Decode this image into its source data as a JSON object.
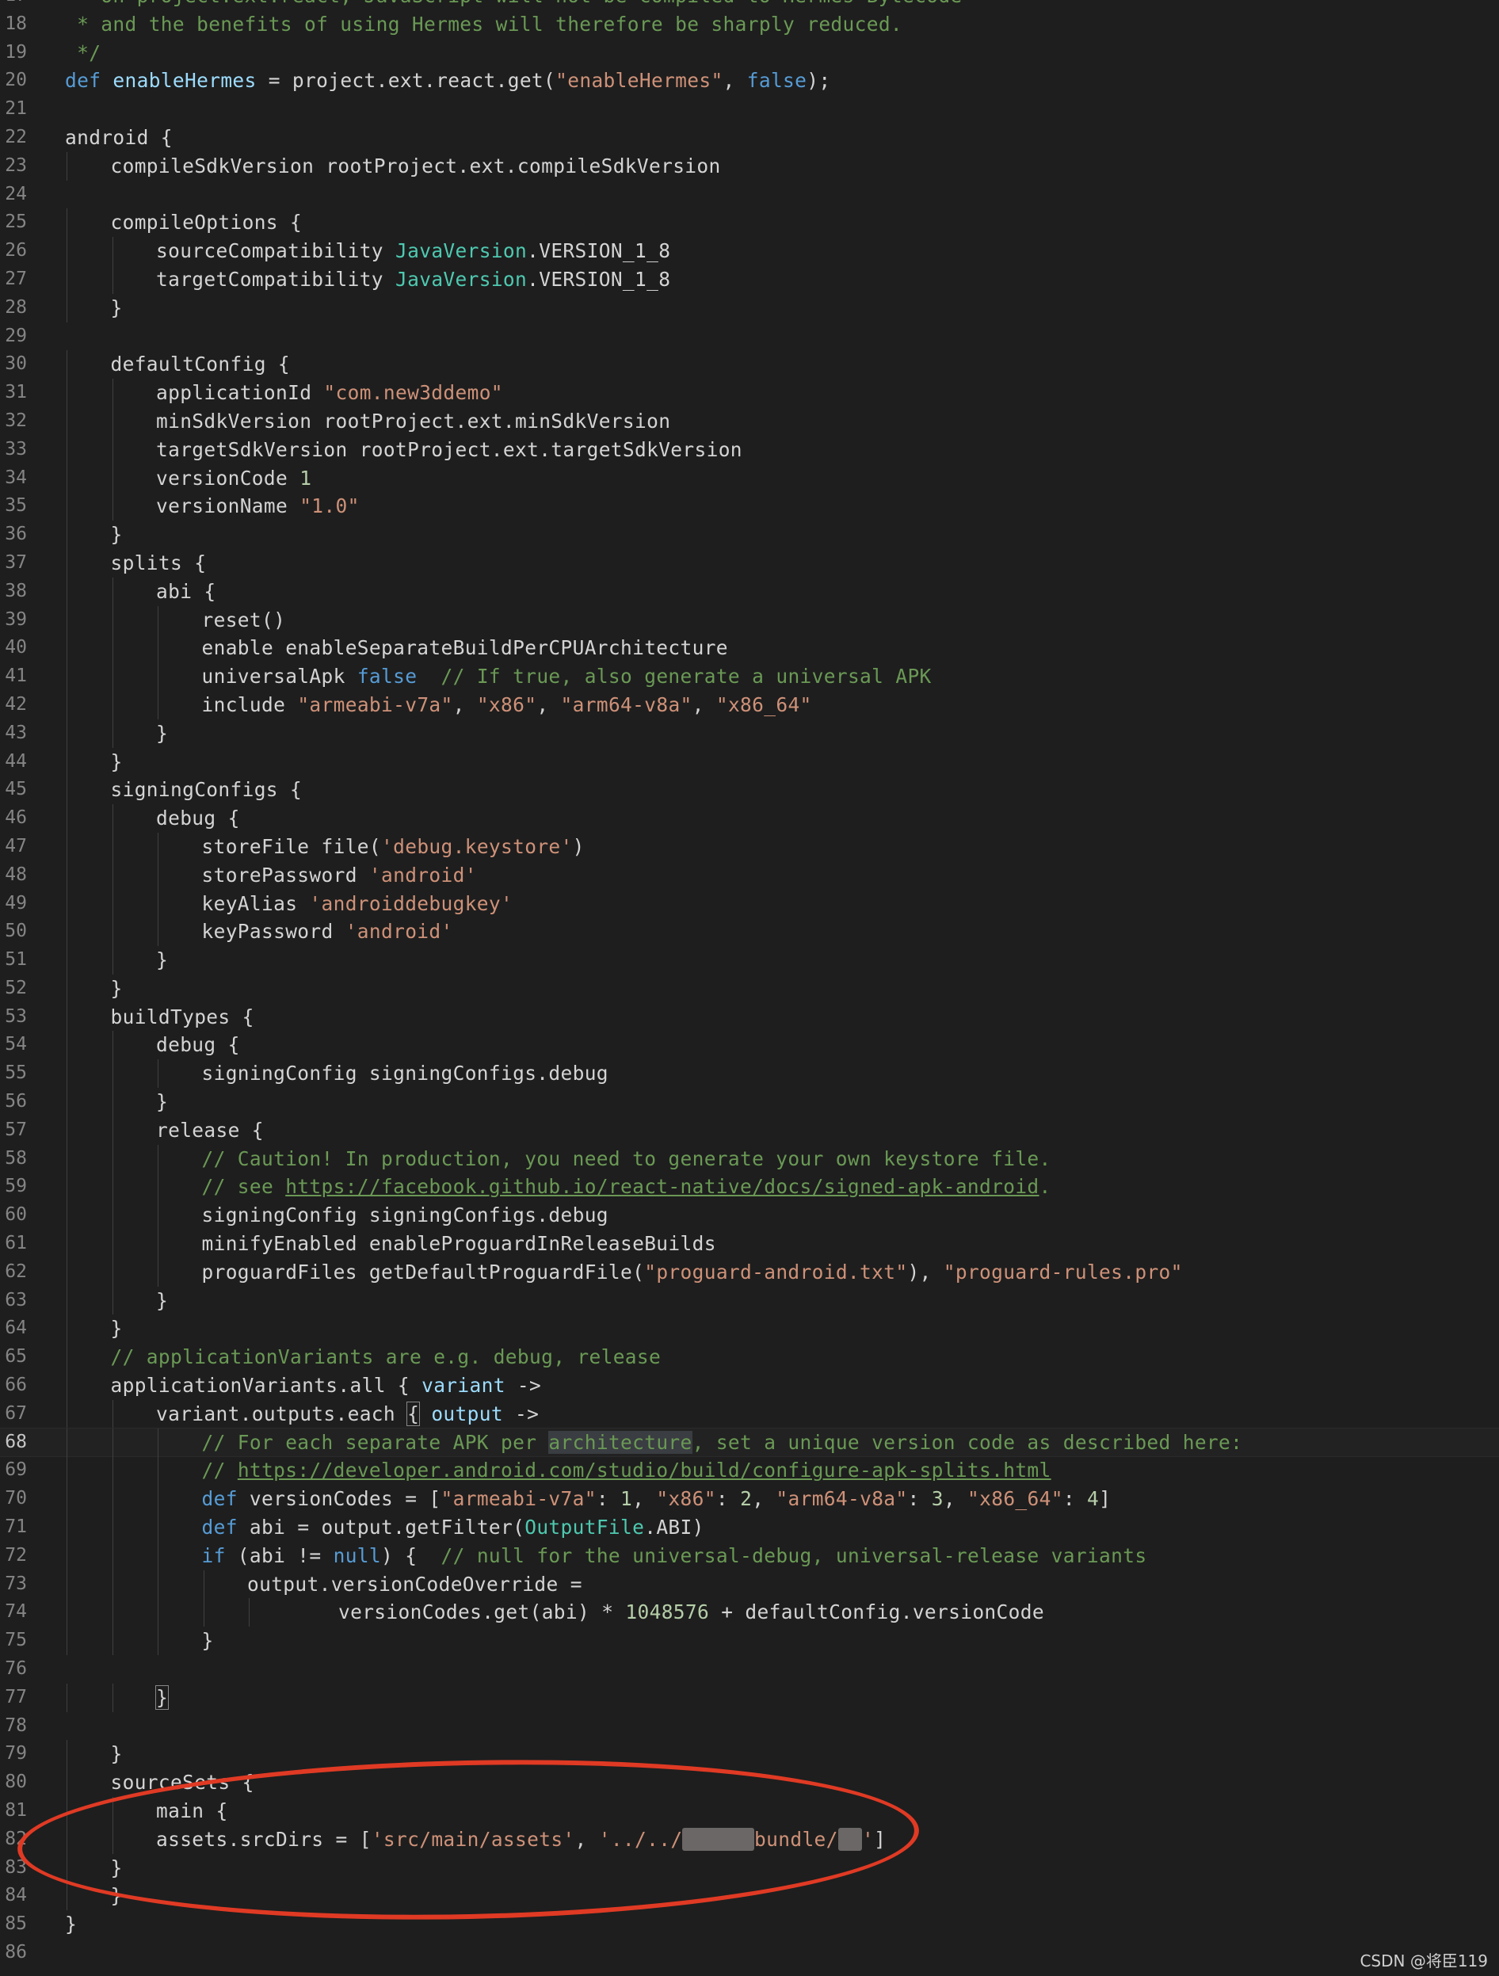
{
  "editor": {
    "current_line": "68",
    "lines": [
      {
        "n": "17",
        "indent": 0,
        "tokens": [
          {
            "t": " * on project.ext.react, JavaScript will not be compiled to Hermes Bytecode",
            "c": "com"
          }
        ]
      },
      {
        "n": "18",
        "indent": 0,
        "tokens": [
          {
            "t": " * and the benefits of using Hermes will therefore be sharply reduced.",
            "c": "com"
          }
        ]
      },
      {
        "n": "19",
        "indent": 0,
        "tokens": [
          {
            "t": " */",
            "c": "com"
          }
        ]
      },
      {
        "n": "20",
        "indent": 0,
        "tokens": [
          {
            "t": "def",
            "c": "kw"
          },
          {
            "t": " "
          },
          {
            "t": "enableHermes",
            "c": "var"
          },
          {
            "t": " = project.ext.react.get("
          },
          {
            "t": "\"enableHermes\"",
            "c": "str"
          },
          {
            "t": ", "
          },
          {
            "t": "false",
            "c": "kw"
          },
          {
            "t": ");"
          }
        ]
      },
      {
        "n": "21",
        "indent": 0,
        "tokens": []
      },
      {
        "n": "22",
        "indent": 0,
        "tokens": [
          {
            "t": "android {"
          }
        ]
      },
      {
        "n": "23",
        "indent": 1,
        "tokens": [
          {
            "t": "compileSdkVersion rootProject.ext.compileSdkVersion"
          }
        ]
      },
      {
        "n": "24",
        "indent": 0,
        "tokens": []
      },
      {
        "n": "25",
        "indent": 1,
        "tokens": [
          {
            "t": "compileOptions {"
          }
        ]
      },
      {
        "n": "26",
        "indent": 2,
        "tokens": [
          {
            "t": "sourceCompatibility "
          },
          {
            "t": "JavaVersion",
            "c": "type"
          },
          {
            "t": ".VERSION_1_8"
          }
        ]
      },
      {
        "n": "27",
        "indent": 2,
        "tokens": [
          {
            "t": "targetCompatibility "
          },
          {
            "t": "JavaVersion",
            "c": "type"
          },
          {
            "t": ".VERSION_1_8"
          }
        ]
      },
      {
        "n": "28",
        "indent": 1,
        "tokens": [
          {
            "t": "}"
          }
        ]
      },
      {
        "n": "29",
        "indent": 0,
        "tokens": []
      },
      {
        "n": "30",
        "indent": 1,
        "tokens": [
          {
            "t": "defaultConfig {"
          }
        ]
      },
      {
        "n": "31",
        "indent": 2,
        "tokens": [
          {
            "t": "applicationId "
          },
          {
            "t": "\"com.new3ddemo\"",
            "c": "str"
          }
        ]
      },
      {
        "n": "32",
        "indent": 2,
        "tokens": [
          {
            "t": "minSdkVersion rootProject.ext.minSdkVersion"
          }
        ]
      },
      {
        "n": "33",
        "indent": 2,
        "tokens": [
          {
            "t": "targetSdkVersion rootProject.ext.targetSdkVersion"
          }
        ]
      },
      {
        "n": "34",
        "indent": 2,
        "tokens": [
          {
            "t": "versionCode "
          },
          {
            "t": "1",
            "c": "num"
          }
        ]
      },
      {
        "n": "35",
        "indent": 2,
        "tokens": [
          {
            "t": "versionName "
          },
          {
            "t": "\"1.0\"",
            "c": "str"
          }
        ]
      },
      {
        "n": "36",
        "indent": 1,
        "tokens": [
          {
            "t": "}"
          }
        ]
      },
      {
        "n": "37",
        "indent": 1,
        "tokens": [
          {
            "t": "splits {"
          }
        ]
      },
      {
        "n": "38",
        "indent": 2,
        "tokens": [
          {
            "t": "abi {"
          }
        ]
      },
      {
        "n": "39",
        "indent": 3,
        "tokens": [
          {
            "t": "reset()"
          }
        ]
      },
      {
        "n": "40",
        "indent": 3,
        "tokens": [
          {
            "t": "enable enableSeparateBuildPerCPUArchitecture"
          }
        ]
      },
      {
        "n": "41",
        "indent": 3,
        "tokens": [
          {
            "t": "universalApk "
          },
          {
            "t": "false",
            "c": "kw"
          },
          {
            "t": "  "
          },
          {
            "t": "// If true, also generate a universal APK",
            "c": "com"
          }
        ]
      },
      {
        "n": "42",
        "indent": 3,
        "tokens": [
          {
            "t": "include "
          },
          {
            "t": "\"armeabi-v7a\"",
            "c": "str"
          },
          {
            "t": ", "
          },
          {
            "t": "\"x86\"",
            "c": "str"
          },
          {
            "t": ", "
          },
          {
            "t": "\"arm64-v8a\"",
            "c": "str"
          },
          {
            "t": ", "
          },
          {
            "t": "\"x86_64\"",
            "c": "str"
          }
        ]
      },
      {
        "n": "43",
        "indent": 2,
        "tokens": [
          {
            "t": "}"
          }
        ]
      },
      {
        "n": "44",
        "indent": 1,
        "tokens": [
          {
            "t": "}"
          }
        ]
      },
      {
        "n": "45",
        "indent": 1,
        "tokens": [
          {
            "t": "signingConfigs {"
          }
        ]
      },
      {
        "n": "46",
        "indent": 2,
        "tokens": [
          {
            "t": "debug {"
          }
        ]
      },
      {
        "n": "47",
        "indent": 3,
        "tokens": [
          {
            "t": "storeFile file("
          },
          {
            "t": "'debug.keystore'",
            "c": "str"
          },
          {
            "t": ")"
          }
        ]
      },
      {
        "n": "48",
        "indent": 3,
        "tokens": [
          {
            "t": "storePassword "
          },
          {
            "t": "'android'",
            "c": "str"
          }
        ]
      },
      {
        "n": "49",
        "indent": 3,
        "tokens": [
          {
            "t": "keyAlias "
          },
          {
            "t": "'androiddebugkey'",
            "c": "str"
          }
        ]
      },
      {
        "n": "50",
        "indent": 3,
        "tokens": [
          {
            "t": "keyPassword "
          },
          {
            "t": "'android'",
            "c": "str"
          }
        ]
      },
      {
        "n": "51",
        "indent": 2,
        "tokens": [
          {
            "t": "}"
          }
        ]
      },
      {
        "n": "52",
        "indent": 1,
        "tokens": [
          {
            "t": "}"
          }
        ]
      },
      {
        "n": "53",
        "indent": 1,
        "tokens": [
          {
            "t": "buildTypes {"
          }
        ]
      },
      {
        "n": "54",
        "indent": 2,
        "tokens": [
          {
            "t": "debug {"
          }
        ]
      },
      {
        "n": "55",
        "indent": 3,
        "tokens": [
          {
            "t": "signingConfig signingConfigs.debug"
          }
        ]
      },
      {
        "n": "56",
        "indent": 2,
        "tokens": [
          {
            "t": "}"
          }
        ]
      },
      {
        "n": "57",
        "indent": 2,
        "tokens": [
          {
            "t": "release {"
          }
        ]
      },
      {
        "n": "58",
        "indent": 3,
        "tokens": [
          {
            "t": "// Caution! In production, you need to generate your own keystore file.",
            "c": "com"
          }
        ]
      },
      {
        "n": "59",
        "indent": 3,
        "tokens": [
          {
            "t": "// see ",
            "c": "com"
          },
          {
            "t": "https://facebook.github.io/react-native/docs/signed-apk-android",
            "c": "link"
          },
          {
            "t": ".",
            "c": "com"
          }
        ]
      },
      {
        "n": "60",
        "indent": 3,
        "tokens": [
          {
            "t": "signingConfig signingConfigs.debug"
          }
        ]
      },
      {
        "n": "61",
        "indent": 3,
        "tokens": [
          {
            "t": "minifyEnabled enableProguardInReleaseBuilds"
          }
        ]
      },
      {
        "n": "62",
        "indent": 3,
        "tokens": [
          {
            "t": "proguardFiles getDefaultProguardFile("
          },
          {
            "t": "\"proguard-android.txt\"",
            "c": "str"
          },
          {
            "t": "), "
          },
          {
            "t": "\"proguard-rules.pro\"",
            "c": "str"
          }
        ]
      },
      {
        "n": "63",
        "indent": 2,
        "tokens": [
          {
            "t": "}"
          }
        ]
      },
      {
        "n": "64",
        "indent": 1,
        "tokens": [
          {
            "t": "}"
          }
        ]
      },
      {
        "n": "65",
        "indent": 1,
        "tokens": [
          {
            "t": "// applicationVariants are e.g. debug, release",
            "c": "com"
          }
        ]
      },
      {
        "n": "66",
        "indent": 1,
        "tokens": [
          {
            "t": "applicationVariants.all { "
          },
          {
            "t": "variant",
            "c": "var"
          },
          {
            "t": " ->"
          }
        ]
      },
      {
        "n": "67",
        "indent": 2,
        "tokens": [
          {
            "t": "variant.outputs.each "
          },
          {
            "t": "{",
            "c": "bracket"
          },
          {
            "t": " "
          },
          {
            "t": "output",
            "c": "var"
          },
          {
            "t": " ->"
          }
        ]
      },
      {
        "n": "68",
        "indent": 3,
        "tokens": [
          {
            "t": "// For each separate APK per ",
            "c": "com"
          },
          {
            "t": "architecture",
            "c": "comhl"
          },
          {
            "t": ", set a unique version code as described here:",
            "c": "com"
          }
        ]
      },
      {
        "n": "69",
        "indent": 3,
        "tokens": [
          {
            "t": "// ",
            "c": "com"
          },
          {
            "t": "https://developer.android.com/studio/build/configure-apk-splits.html",
            "c": "link"
          }
        ]
      },
      {
        "n": "70",
        "indent": 3,
        "tokens": [
          {
            "t": "def",
            "c": "kw"
          },
          {
            "t": " versionCodes = ["
          },
          {
            "t": "\"armeabi-v7a\"",
            "c": "str"
          },
          {
            "t": ": "
          },
          {
            "t": "1",
            "c": "num"
          },
          {
            "t": ", "
          },
          {
            "t": "\"x86\"",
            "c": "str"
          },
          {
            "t": ": "
          },
          {
            "t": "2",
            "c": "num"
          },
          {
            "t": ", "
          },
          {
            "t": "\"arm64-v8a\"",
            "c": "str"
          },
          {
            "t": ": "
          },
          {
            "t": "3",
            "c": "num"
          },
          {
            "t": ", "
          },
          {
            "t": "\"x86_64\"",
            "c": "str"
          },
          {
            "t": ": "
          },
          {
            "t": "4",
            "c": "num"
          },
          {
            "t": "]"
          }
        ]
      },
      {
        "n": "71",
        "indent": 3,
        "tokens": [
          {
            "t": "def",
            "c": "kw"
          },
          {
            "t": " abi = output.getFilter("
          },
          {
            "t": "OutputFile",
            "c": "type"
          },
          {
            "t": ".ABI)"
          }
        ]
      },
      {
        "n": "72",
        "indent": 3,
        "tokens": [
          {
            "t": "if",
            "c": "kw"
          },
          {
            "t": " (abi != "
          },
          {
            "t": "null",
            "c": "kw"
          },
          {
            "t": ") {  "
          },
          {
            "t": "// null for the universal-debug, universal-release variants",
            "c": "com"
          }
        ]
      },
      {
        "n": "73",
        "indent": 4,
        "tokens": [
          {
            "t": "output.versionCodeOverride ="
          }
        ]
      },
      {
        "n": "74",
        "indent": 6,
        "tokens": [
          {
            "t": "versionCodes.get(abi) * "
          },
          {
            "t": "1048576",
            "c": "num"
          },
          {
            "t": " + defaultConfig.versionCode"
          }
        ]
      },
      {
        "n": "75",
        "indent": 3,
        "tokens": [
          {
            "t": "}"
          }
        ]
      },
      {
        "n": "76",
        "indent": 0,
        "tokens": []
      },
      {
        "n": "77",
        "indent": 2,
        "tokens": [
          {
            "t": "}",
            "c": "bracket"
          }
        ]
      },
      {
        "n": "78",
        "indent": 0,
        "tokens": []
      },
      {
        "n": "79",
        "indent": 1,
        "tokens": [
          {
            "t": "}"
          }
        ]
      },
      {
        "n": "80",
        "indent": 1,
        "tokens": [
          {
            "t": "sourceSets {"
          }
        ]
      },
      {
        "n": "81",
        "indent": 2,
        "tokens": [
          {
            "t": "main {"
          }
        ]
      },
      {
        "n": "82",
        "indent": 2,
        "tokens": [
          {
            "t": "assets.srcDirs = ["
          },
          {
            "t": "'src/main/assets'",
            "c": "str"
          },
          {
            "t": ", "
          },
          {
            "t": "'../../",
            "c": "str"
          },
          {
            "t": "XXXXXX",
            "c": "blur"
          },
          {
            "t": "bundle/",
            "c": "str"
          },
          {
            "t": "XX",
            "c": "blur"
          },
          {
            "t": "'",
            "c": "str"
          },
          {
            "t": "]"
          }
        ]
      },
      {
        "n": "83",
        "indent": 1,
        "tokens": [
          {
            "t": "}"
          }
        ]
      },
      {
        "n": "84",
        "indent": 1,
        "tokens": [
          {
            "t": "}"
          }
        ]
      },
      {
        "n": "85",
        "indent": 0,
        "tokens": [
          {
            "t": "}"
          }
        ]
      },
      {
        "n": "86",
        "indent": 0,
        "tokens": []
      }
    ]
  },
  "annotation": {
    "color": "#e03a24"
  },
  "watermark": {
    "text": "CSDN @将臣119"
  },
  "colors": {
    "background": "#1e1e1e",
    "keyword": "#569cd6",
    "string": "#ce9178",
    "comment": "#6a9955",
    "type": "#4ec9b0",
    "number": "#b5cea8",
    "variable": "#9cdcfe"
  }
}
